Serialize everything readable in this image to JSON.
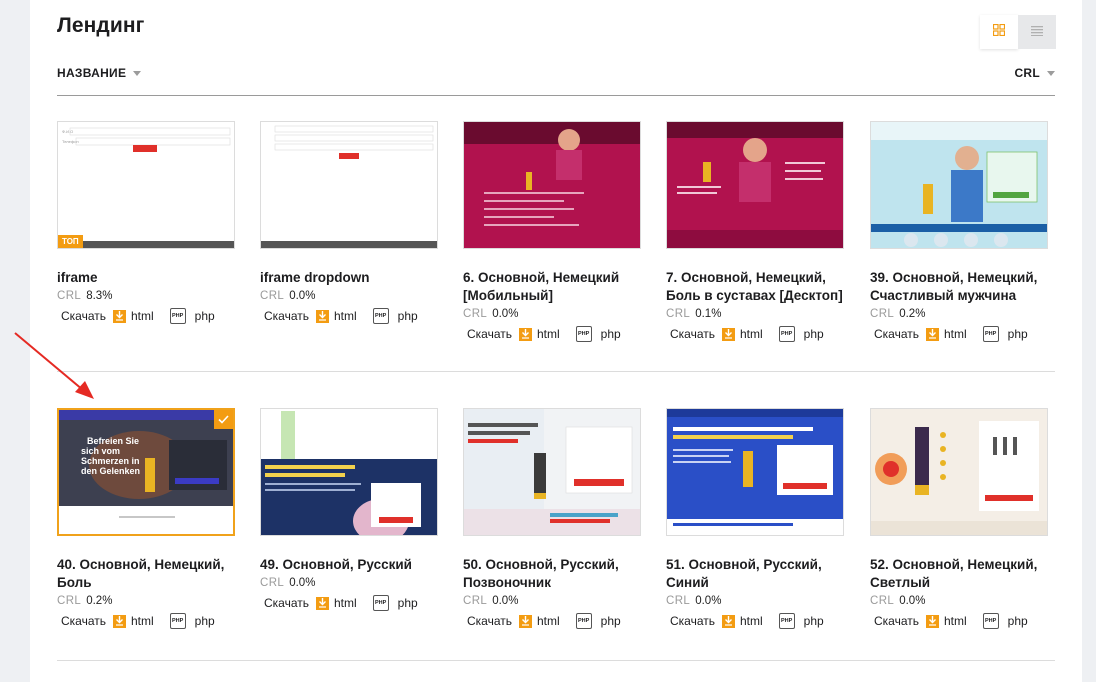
{
  "page": {
    "title": "Лендинг",
    "sort_left": "НАЗВАНИЕ",
    "sort_right": "CRL",
    "colors": {
      "accent": "#f39c12",
      "selected_border": "#f0a21b",
      "annotation_arrow": "#e52a23"
    }
  },
  "download_label": "Скачать",
  "html_label": "html",
  "php_label": "php",
  "php_icon_text": "PHP",
  "crl_label": "CRL",
  "badges": {
    "top": "ТОП"
  },
  "cards": [
    {
      "name": "iframe",
      "crl": "8.3%",
      "thumb": "iframe-form"
    },
    {
      "name": "iframe dropdown",
      "crl": "0.0%",
      "thumb": "iframe-dropdown-form"
    },
    {
      "name": "6. Основной, Немецкий [Мобильный]",
      "crl": "0.0%",
      "thumb": "magenta-mobile"
    },
    {
      "name": "7. Основной, Немецкий, Боль в суставах [Десктоп]",
      "crl": "0.1%",
      "thumb": "magenta-desktop"
    },
    {
      "name": "39. Основной, Немецкий, Счастливый мужчина",
      "crl": "0.2%",
      "thumb": "blue-happy-man"
    },
    {
      "name": "40. Основной, Немецкий, Боль",
      "crl": "0.2%",
      "thumb": "dark-pain"
    },
    {
      "name": "49. Основной, Русский",
      "crl": "0.0%",
      "thumb": "navy-russian"
    },
    {
      "name": "50. Основной, Русский, Позвоночник",
      "crl": "0.0%",
      "thumb": "light-spine"
    },
    {
      "name": "51. Основной, Русский, Синий",
      "crl": "0.0%",
      "thumb": "blue-russian"
    },
    {
      "name": "52. Основной, Немецкий, Светлый",
      "crl": "0.0%",
      "thumb": "beige-light"
    }
  ]
}
